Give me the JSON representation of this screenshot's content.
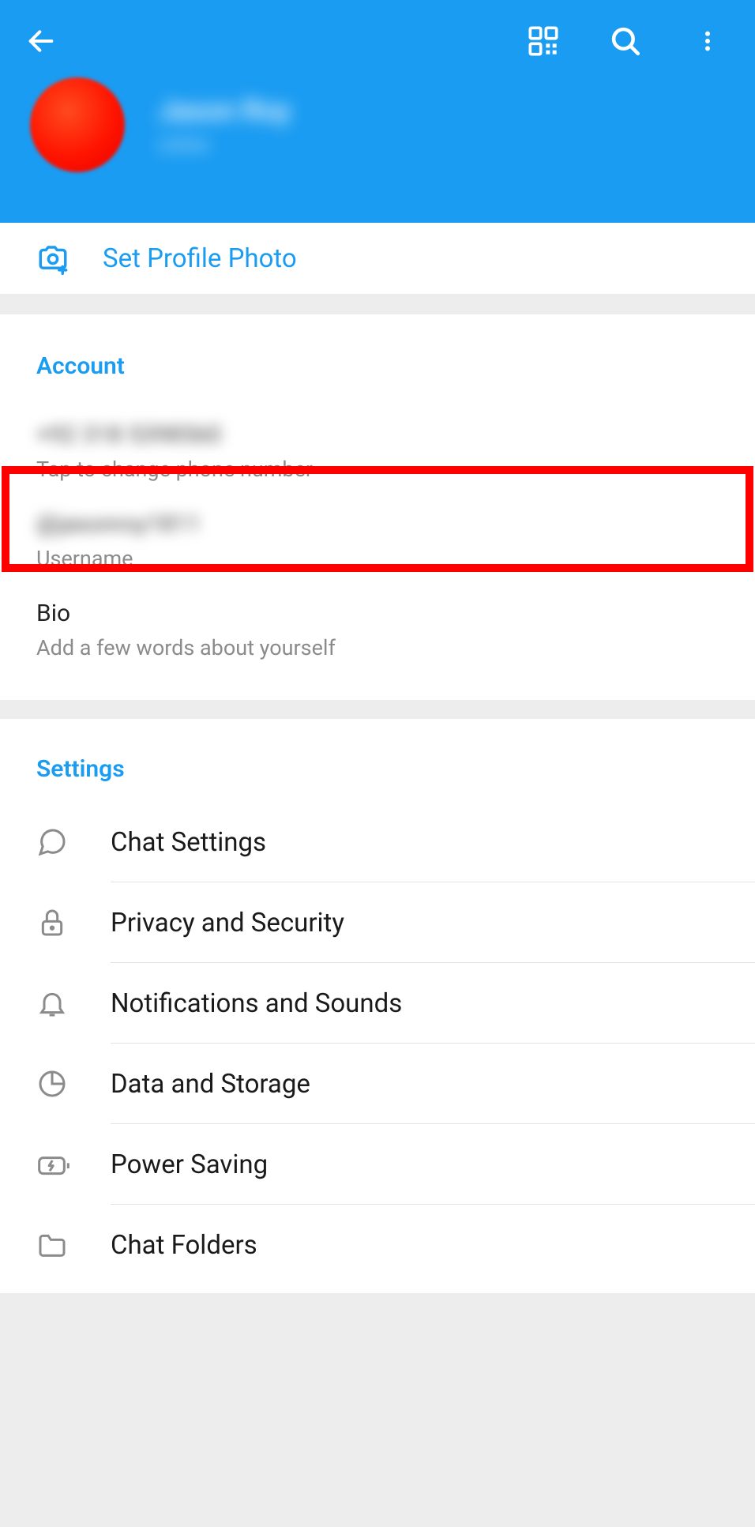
{
  "header": {
    "profile_name": "Jason Roy",
    "profile_status": "online"
  },
  "set_photo": {
    "label": "Set Profile Photo"
  },
  "account": {
    "title": "Account",
    "phone_value": "+92 318 5398560",
    "phone_sub": "Tap to change phone number",
    "username_value": "@jasonroy1811",
    "username_sub": "Username",
    "bio_value": "Bio",
    "bio_sub": "Add a few words about yourself"
  },
  "settings": {
    "title": "Settings",
    "items": [
      {
        "label": "Chat Settings"
      },
      {
        "label": "Privacy and Security"
      },
      {
        "label": "Notifications and Sounds"
      },
      {
        "label": "Data and Storage"
      },
      {
        "label": "Power Saving"
      },
      {
        "label": "Chat Folders"
      }
    ]
  }
}
